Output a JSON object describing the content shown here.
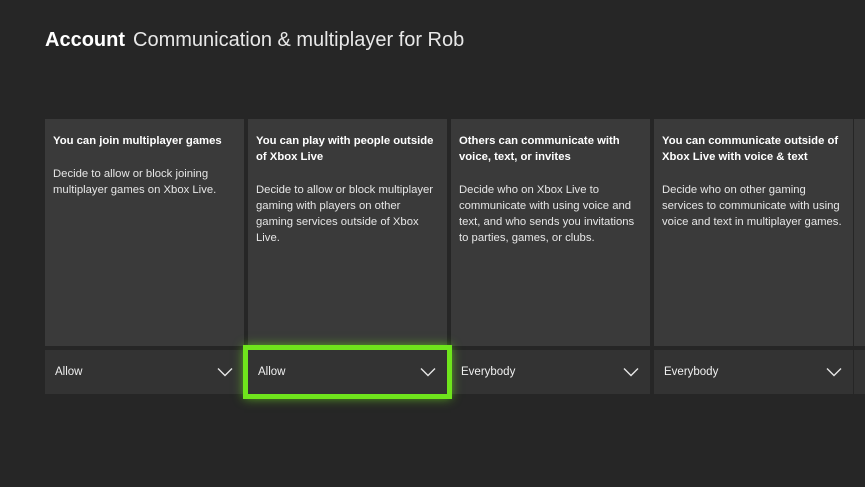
{
  "header": {
    "section": "Account",
    "title": "Communication & multiplayer for Rob"
  },
  "cards": [
    {
      "title": "You can join multiplayer games",
      "description": "Decide to allow or block joining multiplayer games on Xbox Live.",
      "value": "Allow",
      "focused": false
    },
    {
      "title": "You can play with people outside of Xbox Live",
      "description": "Decide to allow or block multiplayer gaming with players on other gaming services outside of Xbox Live.",
      "value": "Allow",
      "focused": true
    },
    {
      "title": "Others can communicate with voice, text, or invites",
      "description": "Decide who on Xbox Live to communicate with using voice and text, and who sends you invitations to parties, games, or clubs.",
      "value": "Everybody",
      "focused": false
    },
    {
      "title": "You can communicate outside of Xbox Live with voice & text",
      "description": "Decide who on other gaming services to communicate with using voice and text in multiplayer games.",
      "value": "Everybody",
      "focused": false
    }
  ],
  "icons": {
    "dropdown": "chevron-down-icon"
  },
  "colors": {
    "background": "#262626",
    "card": "#3a3a3a",
    "focus": "#6fe51c"
  }
}
